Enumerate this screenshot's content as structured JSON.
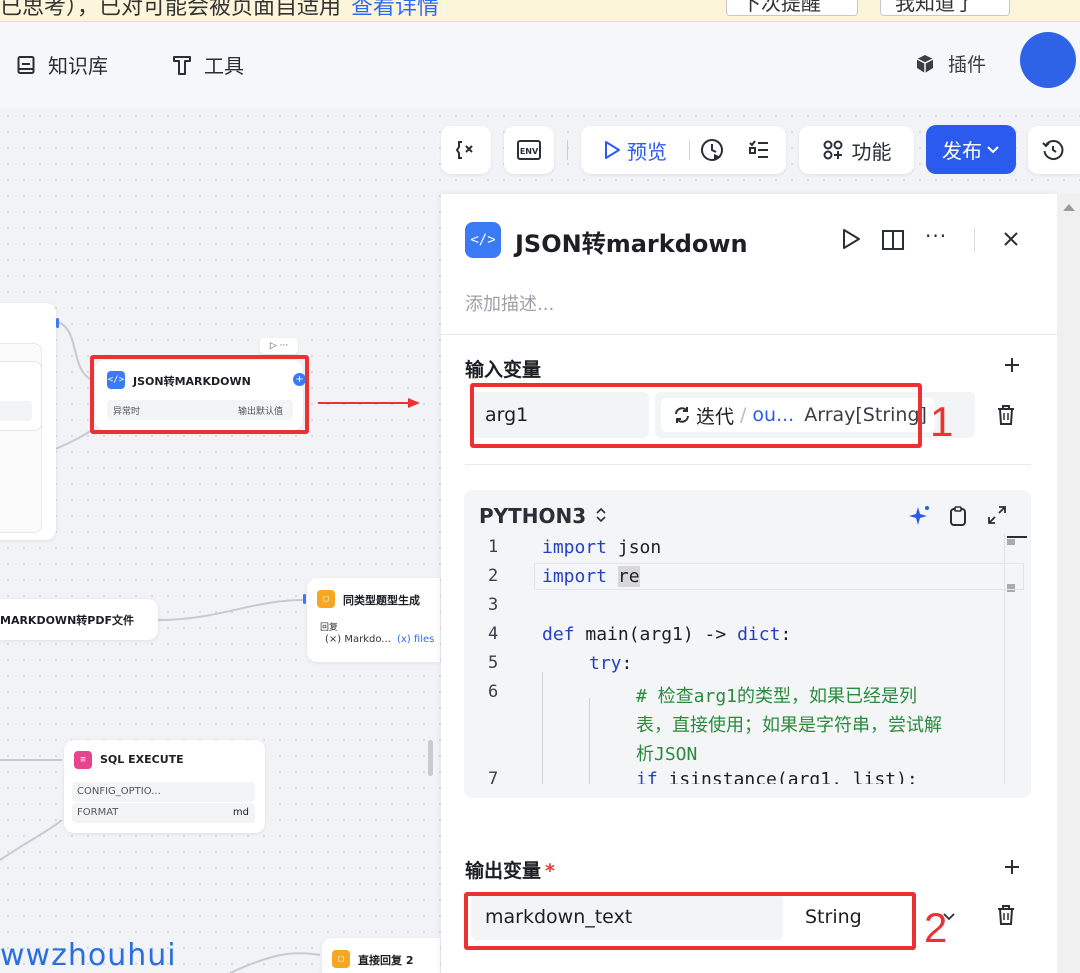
{
  "banner": {
    "text": "已思考），已对可能会被页面自适用",
    "link": "查看详情",
    "btn_remind_later": "下次提醒",
    "btn_remind_me": "我知道了"
  },
  "nav": {
    "knowledge": "知识库",
    "tools": "工具",
    "plugins": "插件"
  },
  "toolbar": {
    "preview": "预览",
    "features": "功能",
    "publish": "发布",
    "env_label": "ENV"
  },
  "canvas": {
    "json_node_title": "JSON转MARKDOWN",
    "json_node_on_error": "异常时",
    "json_node_default": "输出默认值",
    "pdf_node_title": "MARKDOWN转PDF文件",
    "similar_node_title": "同类型题型生成",
    "similar_node_reply": "回复",
    "similar_node_var1": "(×) Markdo...",
    "similar_node_var2": "(x) files",
    "sql_node_title": "SQL EXECUTE",
    "sql_row1_label": "CONFIG_OPTIO...",
    "sql_row2_label": "FORMAT",
    "sql_row2_value": "md",
    "direct_reply_title": "直接回复 2"
  },
  "panel": {
    "title": "JSON转markdown",
    "description_placeholder": "添加描述...",
    "input_section": "输入变量",
    "input_var_name": "arg1",
    "input_source_prefix": "迭代",
    "input_source_sep": "/",
    "input_source_ref": "ou...",
    "input_source_type": "Array[String]",
    "code_language": "PYTHON3",
    "output_section": "输出变量",
    "output_required_mark": "*",
    "output_var_name": "markdown_text",
    "output_var_type": "String"
  },
  "code": {
    "line_numbers": [
      "1",
      "2",
      "3",
      "4",
      "5",
      "6",
      "7"
    ],
    "l1_kw": "import",
    "l1_rest": " json",
    "l2_kw": "import",
    "l2_rest": "re",
    "l4_kw": "def",
    "l4_rest": " main(arg1) -> ",
    "l4_type": "dict",
    "l4_end": ":",
    "l5_kw": "try",
    "l5_end": ":",
    "l6_a": "# 检查arg1的类型，如果已经是列",
    "l6_b": "表，直接使用；如果是字符串，尝试解",
    "l6_c": "析JSON",
    "l7_kw": "if",
    "l7_rest": " isinstance(arg1, list):"
  },
  "annotations": {
    "num1": "1",
    "num2": "2"
  },
  "watermark": "wwzhouhui",
  "colors": {
    "accent_blue": "#2b5bee",
    "annotation_red": "#ea3232",
    "code_keyword": "#2440c8",
    "code_comment": "#2b8a3e"
  }
}
